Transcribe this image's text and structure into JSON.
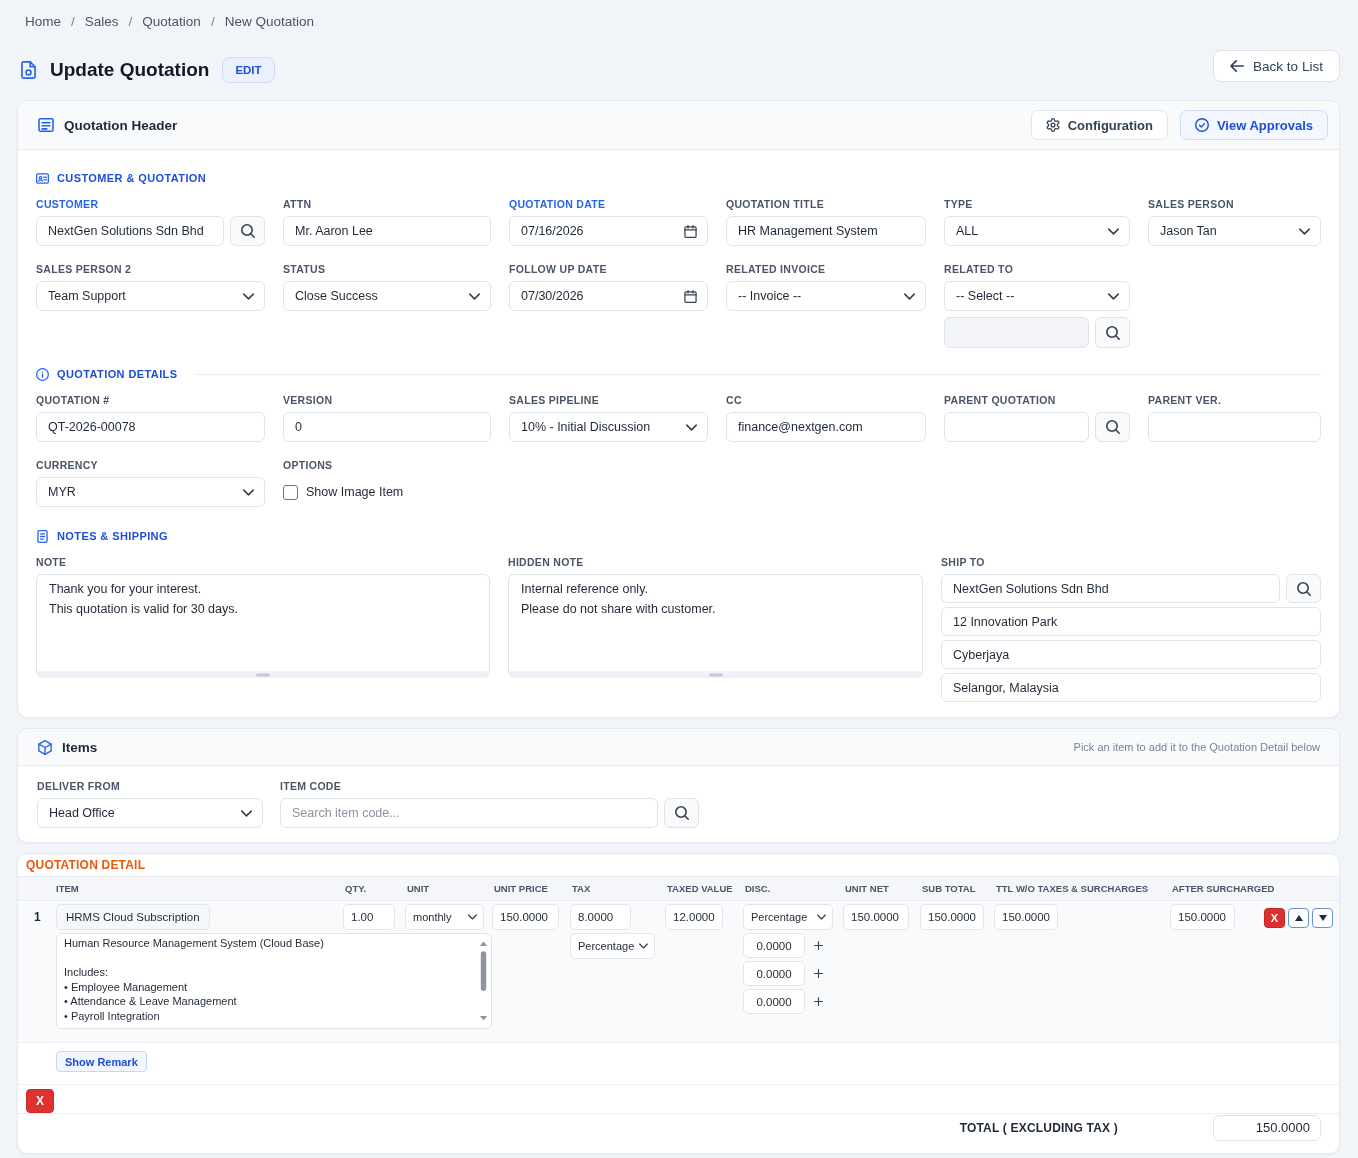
{
  "breadcrumb": [
    {
      "label": "Home"
    },
    {
      "separator": "/",
      "label": "Sales"
    },
    {
      "separator": "/",
      "label": "Quotation"
    },
    {
      "separator": "/",
      "label": "New Quotation"
    }
  ],
  "page": {
    "title": "Update Quotation",
    "badge": "EDIT",
    "back_button": "Back to List"
  },
  "quotation_header": {
    "title": "Quotation Header",
    "buttons": [
      {
        "label": "Configuration",
        "kind": "settings"
      },
      {
        "label": "View Approvals",
        "kind": "approvals"
      }
    ]
  },
  "customer_quotation": {
    "heading": "CUSTOMER & QUOTATION",
    "fields": [
      {
        "label": "CUSTOMER",
        "kind": "lookup",
        "value": "NextGen Solutions Sdn Bhd",
        "required": true,
        "disabled": false
      },
      {
        "label": "ATTN",
        "kind": "text",
        "value": "Mr. Aaron Lee",
        "required": false
      },
      {
        "label": "QUOTATION DATE",
        "kind": "date",
        "value": "07/16/2026",
        "required": true
      },
      {
        "label": "QUOTATION TITLE",
        "kind": "text",
        "value": "HR Management System",
        "required": false
      },
      {
        "label": "TYPE",
        "kind": "select",
        "value": "ALL",
        "required": false
      },
      {
        "label": "SALES PERSON",
        "kind": "select",
        "value": "Jason Tan",
        "required": false
      },
      {
        "label": "SALES PERSON 2",
        "kind": "select",
        "value": "Team Support",
        "required": false
      },
      {
        "label": "STATUS",
        "kind": "select",
        "value": "Close Success",
        "required": false
      },
      {
        "label": "FOLLOW UP DATE",
        "kind": "date",
        "value": "07/30/2026",
        "required": false
      },
      {
        "label": "RELATED INVOICE",
        "kind": "select",
        "value": "-- Invoice --",
        "required": false
      },
      {
        "label": "RELATED TO",
        "kind": "select_lookup",
        "value": "-- Select --",
        "required": false,
        "disabled": true
      }
    ]
  },
  "quotation_details": {
    "heading": "QUOTATION DETAILS",
    "fields": [
      {
        "label": "QUOTATION #",
        "kind": "text",
        "value": "QT-2026-00078",
        "required": false
      },
      {
        "label": "VERSION",
        "kind": "text",
        "value": "0",
        "required": false
      },
      {
        "label": "SALES PIPELINE",
        "kind": "select",
        "value": "10% - Initial Discussion",
        "required": false
      },
      {
        "label": "CC",
        "kind": "text",
        "value": "finance@nextgen.com",
        "required": false
      },
      {
        "label": "PARENT QUOTATION",
        "kind": "lookup",
        "required": false,
        "disabled": false
      },
      {
        "label": "PARENT VER.",
        "kind": "text",
        "required": false
      },
      {
        "label": "CURRENCY",
        "kind": "select",
        "value": "MYR",
        "required": false
      },
      {
        "label": "OPTIONS",
        "kind": "checkbox",
        "text": "Show Image Item",
        "checked": false,
        "required": false
      }
    ]
  },
  "notes_shipping": {
    "heading": "NOTES & SHIPPING",
    "note": {
      "label": "NOTE",
      "value": "Thank you for your interest.\nThis quotation is valid for 30 days."
    },
    "hidden_note": {
      "label": "HIDDEN NOTE",
      "value": "Internal reference only.\nPlease do not share with customer."
    },
    "ship_to": {
      "label": "SHIP TO",
      "lines": [
        "NextGen Solutions Sdn Bhd",
        "12 Innovation Park",
        "Cyberjaya",
        "Selangor, Malaysia"
      ]
    }
  },
  "items": {
    "title": "Items",
    "hint": "Pick an item to add it to the Quotation Detail below",
    "fields": [
      {
        "label": "DELIVER FROM",
        "kind": "select",
        "value": "Head Office",
        "required": false
      },
      {
        "label": "ITEM CODE",
        "kind": "lookup",
        "placeholder": "Search item code...",
        "required": false,
        "disabled": false
      }
    ]
  },
  "quotation_detail": {
    "title": "QUOTATION DETAIL",
    "columns": [
      "ITEM",
      "QTY.",
      "UNIT",
      "UNIT PRICE",
      "TAX",
      "TAXED VALUE",
      "DISC.",
      "UNIT NET",
      "SUB TOTAL",
      "TTL W/O TAXES & SURCHARGES",
      "AFTER SURCHARGED"
    ],
    "rows": [
      {
        "number": "1",
        "item": "HRMS Cloud Subscription",
        "description": "Human Resource Management System (Cloud Base)\n\nIncludes:\n• Employee Management\n• Attendance & Leave Management\n• Payroll Integration",
        "qty": "1.00",
        "unit": "monthly",
        "unit_price": "150.0000",
        "tax": "8.0000",
        "tax_type": "Percentage",
        "taxed_value": "12.0000",
        "discount_type": "Percentage",
        "discounts": [
          "0.0000",
          "0.0000",
          "0.0000"
        ],
        "unit_net": "150.0000",
        "sub_total": "150.0000",
        "total_without_taxes": "150.0000",
        "after_surcharged": "150.0000",
        "delete_button": "X",
        "remark_button": "Show Remark"
      }
    ],
    "remove_button": "X",
    "total_label": "TOTAL ( EXCLUDING TAX )",
    "total": "150.0000"
  }
}
